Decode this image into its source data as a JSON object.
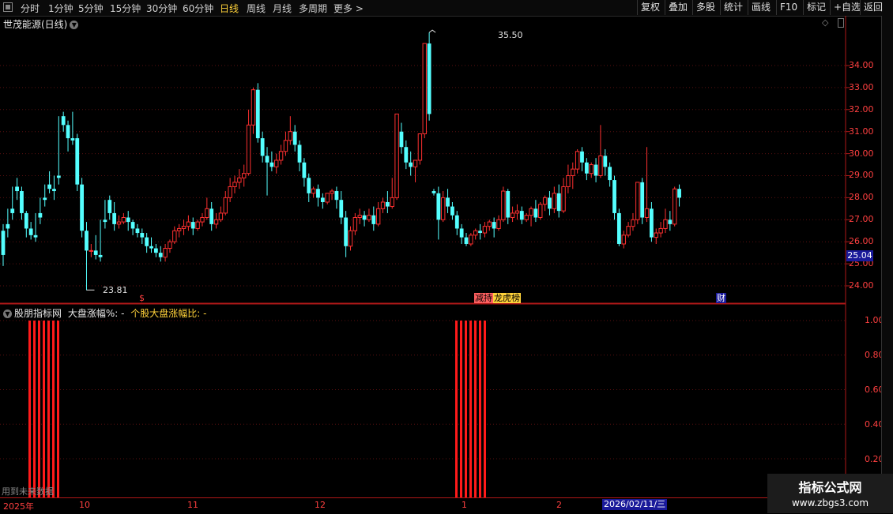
{
  "toolbar": {
    "periods": [
      "分时",
      "1分钟",
      "5分钟",
      "15分钟",
      "30分钟",
      "60分钟",
      "日线",
      "周线",
      "月线",
      "多周期",
      "更多"
    ],
    "active_period": "日线",
    "actions": [
      "复权",
      "叠加",
      "多股",
      "统计",
      "画线",
      "F10",
      "标记",
      "+自选",
      "返回"
    ]
  },
  "chart": {
    "title": "世茂能源(日线)",
    "y_ticks": [
      "34.00",
      "33.00",
      "32.00",
      "31.00",
      "30.00",
      "29.00",
      "28.00",
      "27.00",
      "26.00",
      "25.00",
      "24.00"
    ],
    "current_price": "25.04",
    "high_label": "35.50",
    "low_label": "23.81",
    "badges": [
      "$",
      "减持",
      "龙虎榜",
      "财"
    ]
  },
  "indicator": {
    "name": "股朋指标网",
    "series1_label": "大盘涨幅%: -",
    "series2_label": "个股大盘涨幅比: -",
    "y_ticks": [
      "1.00",
      "0.80",
      "0.60",
      "0.40",
      "0.20"
    ]
  },
  "bottom_axis": {
    "labels": [
      "2025年",
      "10",
      "11",
      "12",
      "1",
      "2"
    ],
    "crosshair_date": "2026/02/11/三"
  },
  "footer_note": "用到未来数据",
  "watermark": {
    "line1": "指标公式网",
    "line2": "www.zbgs3.com"
  },
  "chart_data": {
    "type": "candlestick",
    "candles": [
      [
        26.5,
        26.8,
        25.4,
        24.9
      ],
      [
        26.8,
        27.5,
        26.6,
        26.2
      ],
      [
        27.5,
        28.5,
        27.3,
        27.0
      ],
      [
        28.5,
        28.9,
        28.3,
        27.9
      ],
      [
        28.3,
        28.5,
        27.3,
        27.0
      ],
      [
        27.3,
        27.4,
        26.6,
        26.2
      ],
      [
        26.6,
        26.9,
        26.3,
        26.1
      ],
      [
        26.3,
        27.3,
        26.2,
        26.0
      ],
      [
        27.3,
        28.0,
        27.1,
        26.8
      ],
      [
        28.0,
        28.6,
        27.9,
        27.6
      ],
      [
        28.6,
        29.2,
        28.4,
        28.2
      ],
      [
        28.4,
        29.0,
        28.3,
        27.9
      ],
      [
        29.0,
        31.7,
        28.9,
        28.6
      ],
      [
        31.7,
        31.9,
        31.3,
        31.0
      ],
      [
        31.3,
        31.5,
        30.7,
        30.1
      ],
      [
        30.7,
        31.9,
        30.6,
        30.4
      ],
      [
        30.7,
        30.9,
        28.6,
        28.3
      ],
      [
        28.6,
        28.9,
        26.5,
        26.2
      ],
      [
        26.5,
        26.9,
        25.6,
        23.8
      ],
      [
        25.6,
        25.9,
        25.6,
        25.3
      ],
      [
        25.6,
        26.3,
        25.4,
        25.2
      ],
      [
        25.4,
        27.0,
        25.3,
        25.1
      ],
      [
        27.0,
        27.9,
        26.9,
        26.6
      ],
      [
        27.9,
        28.1,
        27.3,
        27.0
      ],
      [
        27.3,
        27.8,
        26.8,
        26.5
      ],
      [
        26.8,
        27.2,
        26.9,
        26.6
      ],
      [
        26.9,
        27.3,
        27.1,
        26.8
      ],
      [
        27.1,
        27.4,
        26.9,
        26.5
      ],
      [
        26.9,
        27.0,
        26.6,
        26.3
      ],
      [
        26.6,
        26.8,
        26.4,
        26.2
      ],
      [
        26.4,
        26.6,
        26.2,
        25.9
      ],
      [
        26.2,
        26.4,
        25.8,
        25.5
      ],
      [
        25.8,
        26.2,
        25.7,
        25.5
      ],
      [
        25.7,
        25.9,
        25.5,
        25.3
      ],
      [
        25.5,
        25.8,
        25.3,
        25.1
      ],
      [
        25.3,
        25.9,
        25.7,
        25.1
      ],
      [
        25.7,
        26.1,
        26.0,
        25.5
      ],
      [
        26.0,
        26.7,
        26.5,
        25.9
      ],
      [
        26.5,
        26.8,
        26.6,
        26.2
      ],
      [
        26.6,
        27.0,
        26.7,
        26.3
      ],
      [
        26.7,
        27.2,
        26.9,
        26.5
      ],
      [
        26.9,
        27.1,
        26.6,
        26.3
      ],
      [
        26.6,
        27.0,
        26.9,
        26.5
      ],
      [
        26.9,
        27.3,
        27.1,
        26.7
      ],
      [
        27.1,
        28.0,
        27.5,
        27.0
      ],
      [
        27.5,
        27.8,
        26.8,
        26.5
      ],
      [
        26.8,
        27.3,
        27.0,
        26.6
      ],
      [
        27.0,
        27.6,
        27.3,
        26.9
      ],
      [
        27.3,
        28.3,
        28.0,
        27.2
      ],
      [
        28.0,
        28.9,
        28.5,
        27.8
      ],
      [
        28.5,
        29.0,
        28.7,
        28.2
      ],
      [
        28.7,
        29.3,
        28.9,
        28.4
      ],
      [
        28.9,
        29.5,
        29.1,
        28.5
      ],
      [
        29.1,
        32.0,
        31.3,
        29.0
      ],
      [
        31.3,
        33.0,
        32.9,
        30.9
      ],
      [
        32.9,
        33.2,
        30.7,
        30.5
      ],
      [
        30.7,
        31.0,
        29.9,
        29.6
      ],
      [
        29.9,
        30.3,
        29.6,
        28.1
      ],
      [
        29.6,
        30.1,
        29.4,
        29.2
      ],
      [
        29.4,
        30.0,
        29.7,
        29.1
      ],
      [
        29.7,
        30.4,
        30.1,
        29.5
      ],
      [
        30.1,
        31.0,
        30.6,
        29.9
      ],
      [
        30.6,
        31.7,
        31.0,
        30.4
      ],
      [
        31.0,
        31.3,
        30.4,
        30.1
      ],
      [
        30.4,
        30.6,
        29.6,
        29.2
      ],
      [
        29.6,
        29.8,
        28.9,
        28.5
      ],
      [
        28.9,
        29.1,
        28.2,
        27.8
      ],
      [
        28.2,
        28.5,
        28.4,
        28.0
      ],
      [
        28.4,
        28.6,
        28.0,
        27.6
      ],
      [
        28.0,
        28.2,
        27.8,
        27.5
      ],
      [
        27.8,
        28.0,
        28.2,
        27.7
      ],
      [
        28.2,
        28.4,
        28.3,
        27.9
      ],
      [
        28.3,
        28.5,
        27.9,
        27.5
      ],
      [
        27.9,
        28.3,
        27.1,
        26.8
      ],
      [
        27.1,
        27.4,
        25.8,
        25.3
      ],
      [
        25.8,
        26.7,
        26.5,
        25.6
      ],
      [
        26.5,
        27.3,
        27.1,
        26.3
      ],
      [
        27.1,
        27.5,
        27.2,
        26.8
      ],
      [
        27.2,
        27.4,
        27.0,
        26.7
      ],
      [
        27.0,
        27.5,
        27.2,
        26.9
      ],
      [
        27.2,
        27.6,
        26.8,
        26.5
      ],
      [
        26.8,
        27.8,
        27.5,
        26.7
      ],
      [
        27.5,
        28.0,
        27.8,
        27.3
      ],
      [
        27.8,
        28.3,
        27.6,
        27.3
      ],
      [
        27.6,
        28.9,
        28.0,
        27.5
      ],
      [
        28.0,
        31.0,
        31.8,
        27.9
      ],
      [
        31.0,
        31.4,
        30.3,
        30.0
      ],
      [
        30.3,
        30.6,
        29.6,
        29.3
      ],
      [
        29.6,
        30.1,
        29.4,
        29.0
      ],
      [
        29.4,
        29.7,
        29.7,
        28.7
      ],
      [
        29.7,
        30.0,
        30.9,
        29.5
      ],
      [
        30.9,
        34.9,
        35.0,
        30.7
      ],
      [
        35.0,
        35.5,
        31.8,
        31.5
      ],
      [
        28.3,
        28.4,
        28.2,
        28.1
      ],
      [
        28.2,
        28.5,
        27.0,
        26.1
      ],
      [
        27.0,
        28.3,
        28.0,
        26.9
      ],
      [
        28.0,
        28.4,
        27.6,
        27.3
      ],
      [
        27.6,
        27.8,
        27.2,
        27.0
      ],
      [
        27.2,
        27.4,
        26.6,
        26.3
      ],
      [
        26.6,
        26.8,
        26.2,
        25.9
      ],
      [
        26.2,
        26.4,
        25.9,
        25.8
      ],
      [
        25.9,
        26.4,
        26.3,
        25.8
      ],
      [
        26.3,
        26.6,
        26.5,
        26.1
      ],
      [
        26.5,
        26.8,
        26.4,
        26.1
      ],
      [
        26.4,
        26.9,
        26.7,
        26.2
      ],
      [
        26.7,
        27.0,
        26.9,
        26.5
      ],
      [
        26.9,
        27.1,
        26.6,
        26.2
      ],
      [
        26.6,
        27.2,
        27.0,
        26.5
      ],
      [
        27.0,
        28.5,
        28.3,
        26.9
      ],
      [
        28.3,
        28.4,
        27.1,
        26.8
      ],
      [
        27.1,
        27.6,
        27.3,
        26.9
      ],
      [
        27.3,
        27.7,
        27.4,
        27.0
      ],
      [
        27.4,
        27.6,
        27.0,
        26.8
      ],
      [
        27.0,
        27.3,
        27.2,
        26.9
      ],
      [
        27.2,
        27.6,
        27.5,
        26.7
      ],
      [
        27.5,
        27.9,
        27.1,
        26.9
      ],
      [
        27.1,
        27.8,
        27.7,
        27.0
      ],
      [
        27.7,
        28.1,
        28.0,
        27.4
      ],
      [
        28.0,
        28.3,
        27.5,
        27.2
      ],
      [
        27.5,
        28.5,
        28.2,
        27.3
      ],
      [
        28.2,
        28.6,
        27.4,
        27.1
      ],
      [
        27.4,
        28.9,
        28.5,
        27.3
      ],
      [
        28.5,
        29.5,
        29.0,
        28.2
      ],
      [
        29.0,
        29.6,
        29.3,
        28.4
      ],
      [
        29.3,
        30.2,
        30.1,
        29.1
      ],
      [
        30.1,
        30.3,
        29.6,
        29.2
      ],
      [
        29.6,
        29.8,
        29.1,
        28.8
      ],
      [
        29.1,
        29.6,
        29.5,
        28.9
      ],
      [
        29.5,
        29.8,
        29.0,
        28.7
      ],
      [
        29.0,
        31.3,
        29.9,
        28.9
      ],
      [
        29.9,
        30.2,
        29.4,
        29.0
      ],
      [
        29.4,
        29.6,
        28.8,
        28.5
      ],
      [
        28.8,
        29.0,
        27.3,
        27.0
      ],
      [
        27.3,
        27.5,
        25.9,
        25.8
      ],
      [
        25.9,
        26.5,
        26.3,
        25.7
      ],
      [
        26.3,
        26.9,
        26.7,
        26.2
      ],
      [
        26.7,
        27.3,
        27.0,
        26.5
      ],
      [
        27.0,
        28.5,
        28.7,
        26.8
      ],
      [
        28.7,
        28.9,
        27.1,
        26.8
      ],
      [
        27.1,
        30.3,
        27.5,
        26.9
      ],
      [
        27.5,
        27.8,
        26.2,
        26.0
      ],
      [
        26.2,
        26.6,
        26.4,
        25.9
      ],
      [
        26.4,
        26.9,
        26.6,
        26.2
      ],
      [
        26.6,
        27.5,
        27.0,
        26.4
      ],
      [
        27.0,
        27.4,
        26.8,
        26.5
      ],
      [
        26.8,
        28.5,
        28.4,
        26.7
      ],
      [
        28.4,
        28.6,
        28.0,
        27.6
      ]
    ]
  }
}
